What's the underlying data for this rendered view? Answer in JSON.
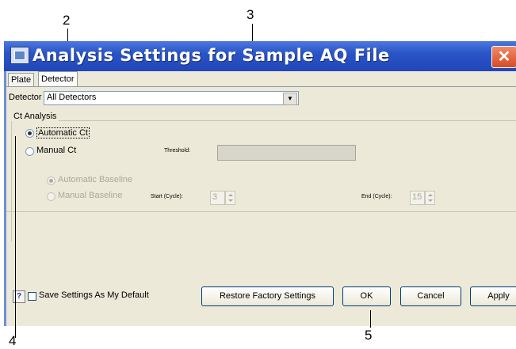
{
  "callouts": {
    "c2": "2",
    "c3": "3",
    "c4": "4",
    "c5": "5"
  },
  "window": {
    "title": "Analysis Settings for Sample AQ File",
    "close_glyph": "✕"
  },
  "tabs": [
    {
      "label": "Plate"
    },
    {
      "label": "Detector"
    }
  ],
  "detector": {
    "label": "Detector",
    "value": "All Detectors"
  },
  "ct_analysis": {
    "group_title": "Ct Analysis",
    "automatic_ct": "Automatic Ct",
    "manual_ct": "Manual Ct",
    "threshold_label": "Threshold:",
    "automatic_baseline": "Automatic Baseline",
    "manual_baseline": "Manual Baseline",
    "start_label": "Start (Cycle):",
    "start_value": "3",
    "end_label": "End (Cycle):",
    "end_value": "15"
  },
  "footer": {
    "help_glyph": "?",
    "save_default_label": "Save Settings As My Default",
    "restore_label": "Restore Factory Settings",
    "ok_label": "OK",
    "cancel_label": "Cancel",
    "apply_label": "Apply"
  }
}
